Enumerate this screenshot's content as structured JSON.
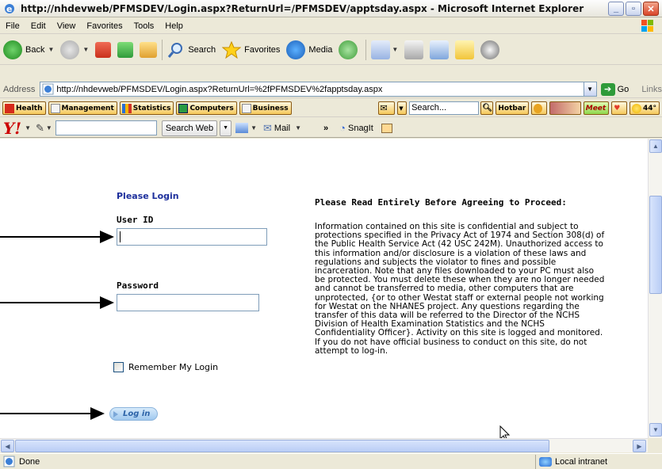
{
  "window": {
    "title": "http://nhdevweb/PFMSDEV/Login.aspx?ReturnUrl=/PFMSDEV/apptsday.aspx - Microsoft Internet Explorer"
  },
  "menu": [
    "File",
    "Edit",
    "View",
    "Favorites",
    "Tools",
    "Help"
  ],
  "toolbar": {
    "back": "Back",
    "search": "Search",
    "favorites": "Favorites",
    "media": "Media"
  },
  "address": {
    "label": "Address",
    "url": "http://nhdevweb/PFMSDEV/Login.aspx?ReturnUrl=%2fPFMSDEV%2fapptsday.aspx",
    "go": "Go",
    "links": "Links"
  },
  "links_bar": {
    "health": "Health",
    "management": "Management",
    "statistics": "Statistics",
    "computers": "Computers",
    "business": "Business",
    "search_placeholder": "Search...",
    "hotbar": "Hotbar",
    "meet": "Meet",
    "weather": "44°"
  },
  "yahoo_bar": {
    "search_web": "Search Web",
    "mail": "Mail",
    "more": "»",
    "snagit": "SnagIt"
  },
  "page": {
    "heading": "Please Login",
    "user_id_label": "User ID",
    "password_label": "Password",
    "remember_label": "Remember My Login",
    "login_button": "Log in",
    "notice_title": "Please Read Entirely Before Agreeing to Proceed:",
    "notice_body": "Information contained on this site is confidential and subject to protections specified in the Privacy Act of 1974 and Section 308(d) of the Public Health Service Act (42 USC 242M). Unauthorized access to this information and/or disclosure is a violation of these laws and regulations and subjects the violator to fines and possible incarceration. Note that any files downloaded to your PC must also be protected. You must delete these when they are no longer needed and cannot be transferred to media, other computers that are unprotected, {or to other Westat staff or external people not working for Westat on the NHANES project. Any questions regarding the transfer of this data will be referred to the Director of the NCHS Division of Health Examination Statistics and the NCHS Confidentiality Officer}. Activity on this site is logged and monitored. If you do not have official business to conduct on this site, do not attempt to log-in."
  },
  "status": {
    "left": "Done",
    "zone": "Local intranet"
  }
}
